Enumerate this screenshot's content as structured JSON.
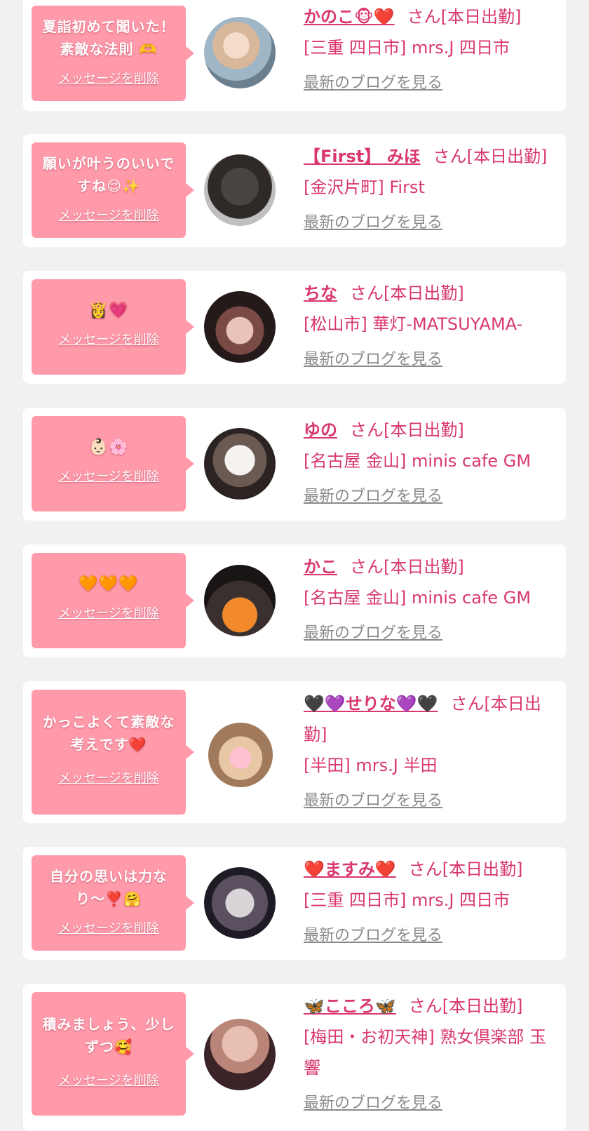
{
  "delete_label": "メッセージを削除",
  "blog_label": "最新のブログを見る",
  "status_label": "さん[本日出勤]",
  "colors": {
    "bubble": "#ff9aaa",
    "accent": "#d9376e",
    "link_gray": "#8a8a8a",
    "background": "#f1f1f1"
  },
  "cards": [
    {
      "message": "夏詣初めて聞いた！素敵な法則 🫶",
      "name": "かのこ🐵❤️",
      "shop": "[三重 四日市] mrs.J 四日市"
    },
    {
      "message": "願いが叶うのいいですね😌✨",
      "name": "【First】 みほ",
      "shop": "[金沢片町] First"
    },
    {
      "message": "👸💗",
      "name": "ちな",
      "shop": "[松山市] 華灯-MATSUYAMA-"
    },
    {
      "message": "👶🏻🌸",
      "name": "ゆの",
      "shop": "[名古屋 金山] minis cafe GM"
    },
    {
      "message": "🧡🧡🧡",
      "name": "かこ",
      "shop": "[名古屋 金山] minis cafe GM"
    },
    {
      "message": "かっこよくて素敵な考えです❤️",
      "name": "🖤💜せりな💜🖤",
      "shop": "[半田] mrs.J 半田"
    },
    {
      "message": "自分の思いは力なり〜❣️🤗",
      "name": "❤️ますみ❤️",
      "shop": "[三重 四日市] mrs.J 四日市"
    },
    {
      "message": "積みましょう、少しずつ🥰",
      "name": "🦋こころ🦋",
      "shop": "[梅田・お初天神] 熟女倶楽部 玉響"
    }
  ]
}
